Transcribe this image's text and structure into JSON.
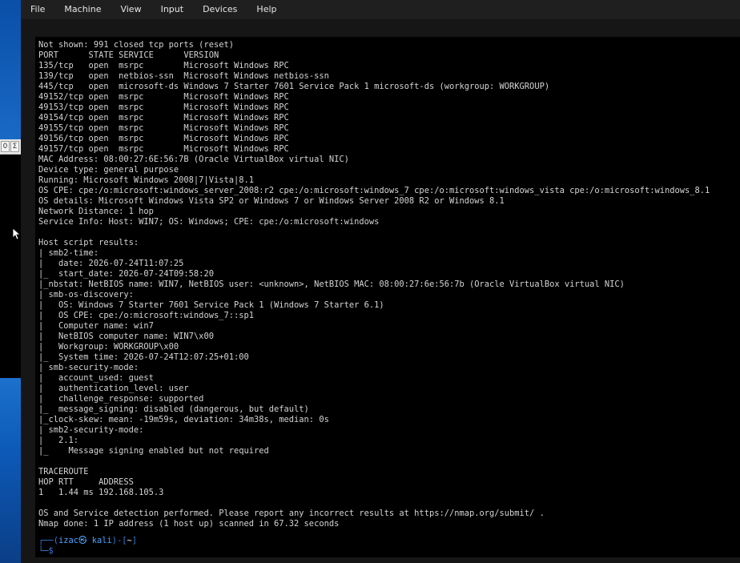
{
  "menubar": {
    "items": [
      "File",
      "Machine",
      "View",
      "Input",
      "Devices",
      "Help"
    ]
  },
  "host": {
    "window_buttons": [
      "0",
      "Σ"
    ]
  },
  "terminal": {
    "lines": [
      "Not shown: 991 closed tcp ports (reset)",
      "PORT      STATE SERVICE      VERSION",
      "135/tcp   open  msrpc        Microsoft Windows RPC",
      "139/tcp   open  netbios-ssn  Microsoft Windows netbios-ssn",
      "445/tcp   open  microsoft-ds Windows 7 Starter 7601 Service Pack 1 microsoft-ds (workgroup: WORKGROUP)",
      "49152/tcp open  msrpc        Microsoft Windows RPC",
      "49153/tcp open  msrpc        Microsoft Windows RPC",
      "49154/tcp open  msrpc        Microsoft Windows RPC",
      "49155/tcp open  msrpc        Microsoft Windows RPC",
      "49156/tcp open  msrpc        Microsoft Windows RPC",
      "49157/tcp open  msrpc        Microsoft Windows RPC",
      "MAC Address: 08:00:27:6E:56:7B (Oracle VirtualBox virtual NIC)",
      "Device type: general purpose",
      "Running: Microsoft Windows 2008|7|Vista|8.1",
      "OS CPE: cpe:/o:microsoft:windows_server_2008:r2 cpe:/o:microsoft:windows_7 cpe:/o:microsoft:windows_vista cpe:/o:microsoft:windows_8.1",
      "OS details: Microsoft Windows Vista SP2 or Windows 7 or Windows Server 2008 R2 or Windows 8.1",
      "Network Distance: 1 hop",
      "Service Info: Host: WIN7; OS: Windows; CPE: cpe:/o:microsoft:windows",
      "",
      "Host script results:",
      "| smb2-time:",
      "|   date: 2026-07-24T11:07:25",
      "|_  start_date: 2026-07-24T09:58:20",
      "|_nbstat: NetBIOS name: WIN7, NetBIOS user: <unknown>, NetBIOS MAC: 08:00:27:6e:56:7b (Oracle VirtualBox virtual NIC)",
      "| smb-os-discovery:",
      "|   OS: Windows 7 Starter 7601 Service Pack 1 (Windows 7 Starter 6.1)",
      "|   OS CPE: cpe:/o:microsoft:windows_7::sp1",
      "|   Computer name: win7",
      "|   NetBIOS computer name: WIN7\\x00",
      "|   Workgroup: WORKGROUP\\x00",
      "|_  System time: 2026-07-24T12:07:25+01:00",
      "| smb-security-mode:",
      "|   account_used: guest",
      "|   authentication_level: user",
      "|   challenge_response: supported",
      "|_  message_signing: disabled (dangerous, but default)",
      "|_clock-skew: mean: -19m59s, deviation: 34m38s, median: 0s",
      "| smb2-security-mode:",
      "|   2.1:",
      "|_    Message signing enabled but not required",
      "",
      "TRACEROUTE",
      "HOP RTT     ADDRESS",
      "1   1.44 ms 192.168.105.3",
      "",
      "OS and Service detection performed. Please report any incorrect results at https://nmap.org/submit/ .",
      "Nmap done: 1 IP address (1 host up) scanned in 67.32 seconds"
    ],
    "prompt": {
      "line1_prefix": "┌──(",
      "user_host": "izac㉿ kali",
      "line1_mid": ")-[",
      "path": "~",
      "line1_suffix": "]",
      "line2_prefix": "└─",
      "dollar": "$"
    }
  }
}
